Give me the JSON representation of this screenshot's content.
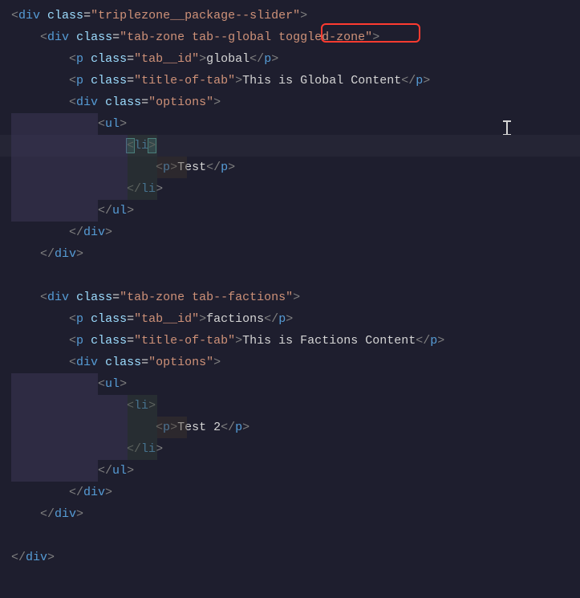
{
  "code": {
    "l1": {
      "open": "<",
      "tag": "div",
      "sp": " ",
      "attr": "class",
      "eq": "=",
      "q1": "\"",
      "val": "triplezone__package--slider",
      "q2": "\"",
      "close": ">"
    },
    "l2": {
      "open": "<",
      "tag": "div",
      "sp": " ",
      "attr": "class",
      "eq": "=",
      "q1": "\"",
      "val_a": "tab-zone tab--global ",
      "val_b": "toggled-zone",
      "q2": "\"",
      "close": ">"
    },
    "l3": {
      "open": "<",
      "tag": "p",
      "sp": " ",
      "attr": "class",
      "eq": "=",
      "q1": "\"",
      "val": "tab__id",
      "q2": "\"",
      "close1": ">",
      "text": "global",
      "open2": "</",
      "tag2": "p",
      "close2": ">"
    },
    "l4": {
      "open": "<",
      "tag": "p",
      "sp": " ",
      "attr": "class",
      "eq": "=",
      "q1": "\"",
      "val": "title-of-tab",
      "q2": "\"",
      "close1": ">",
      "text": "This is Global Content",
      "open2": "</",
      "tag2": "p",
      "close2": ">"
    },
    "l5": {
      "open": "<",
      "tag": "div",
      "sp": " ",
      "attr": "class",
      "eq": "=",
      "q1": "\"",
      "val": "options",
      "q2": "\"",
      "close": ">"
    },
    "l6": {
      "open": "<",
      "tag": "ul",
      "close": ">"
    },
    "l7": {
      "open_b": "<",
      "tag": "li",
      "close_b": ">"
    },
    "l8": {
      "open": "<",
      "tag": "p",
      "close1": ">",
      "text": "Test",
      "open2": "</",
      "tag2": "p",
      "close2": ">"
    },
    "l9": {
      "open": "</",
      "tag": "li",
      "close": ">"
    },
    "l10": {
      "open": "</",
      "tag": "ul",
      "close": ">"
    },
    "l11": {
      "open": "</",
      "tag": "div",
      "close": ">"
    },
    "l12": {
      "open": "</",
      "tag": "div",
      "close": ">"
    },
    "l13": "",
    "l14": {
      "open": "<",
      "tag": "div",
      "sp": " ",
      "attr": "class",
      "eq": "=",
      "q1": "\"",
      "val": "tab-zone tab--factions",
      "q2": "\"",
      "close": ">"
    },
    "l15": {
      "open": "<",
      "tag": "p",
      "sp": " ",
      "attr": "class",
      "eq": "=",
      "q1": "\"",
      "val": "tab__id",
      "q2": "\"",
      "close1": ">",
      "text": "factions",
      "open2": "</",
      "tag2": "p",
      "close2": ">"
    },
    "l16": {
      "open": "<",
      "tag": "p",
      "sp": " ",
      "attr": "class",
      "eq": "=",
      "q1": "\"",
      "val": "title-of-tab",
      "q2": "\"",
      "close1": ">",
      "text": "This is Factions Content",
      "open2": "</",
      "tag2": "p",
      "close2": ">"
    },
    "l17": {
      "open": "<",
      "tag": "div",
      "sp": " ",
      "attr": "class",
      "eq": "=",
      "q1": "\"",
      "val": "options",
      "q2": "\"",
      "close": ">"
    },
    "l18": {
      "open": "<",
      "tag": "ul",
      "close": ">"
    },
    "l19": {
      "open": "<",
      "tag": "li",
      "close": ">"
    },
    "l20": {
      "open": "<",
      "tag": "p",
      "close1": ">",
      "text": "Test 2",
      "open2": "</",
      "tag2": "p",
      "close2": ">"
    },
    "l21": {
      "open": "</",
      "tag": "li",
      "close": ">"
    },
    "l22": {
      "open": "</",
      "tag": "ul",
      "close": ">"
    },
    "l23": {
      "open": "</",
      "tag": "div",
      "close": ">"
    },
    "l24": {
      "open": "</",
      "tag": "div",
      "close": ">"
    },
    "l25": "",
    "l26": {
      "open": "</",
      "tag": "div",
      "close": ">"
    }
  },
  "highlight": {
    "text": "toggled-zone"
  }
}
